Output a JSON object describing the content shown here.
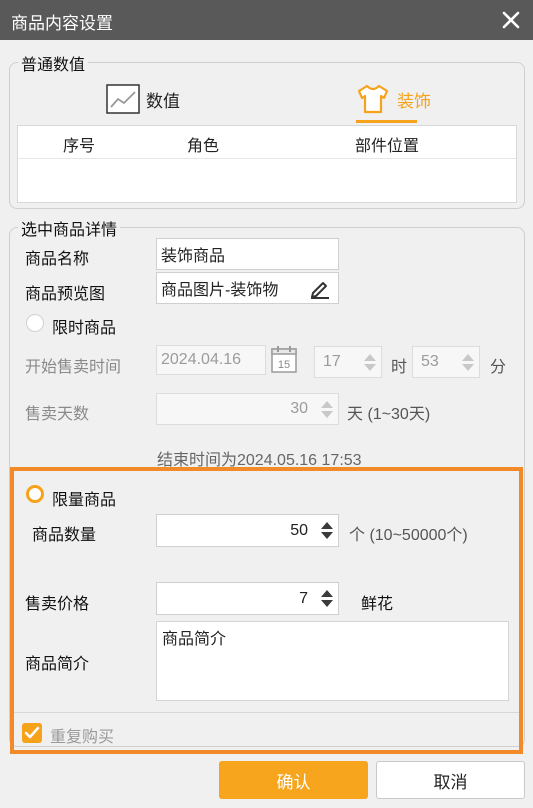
{
  "window": {
    "title": "商品内容设置"
  },
  "normal_values": {
    "legend": "普通数值",
    "tabs": [
      {
        "label": "数值",
        "icon": "chart-icon",
        "active": false
      },
      {
        "label": "装饰",
        "icon": "shirt-icon",
        "active": true
      }
    ],
    "table_headers": [
      "序号",
      "角色",
      "部件位置"
    ],
    "accent_color": "#f6a21a"
  },
  "details": {
    "legend": "选中商品详情",
    "name_label": "商品名称",
    "name_value": "装饰商品",
    "preview_label": "商品预览图",
    "preview_value": "商品图片-装饰物",
    "limited_time_label": "限时商品",
    "start_time_label": "开始售卖时间",
    "start_date": "2024.04.16",
    "calendar_day": "15",
    "hour": "17",
    "hour_unit": "时",
    "minute": "53",
    "minute_unit": "分",
    "days_label": "售卖天数",
    "days_value": "30",
    "days_hint": "天 (1~30天)",
    "end_time_text": "结束时间为2024.05.16 17:53",
    "limited_qty_label": "限量商品",
    "qty_label": "商品数量",
    "qty_value": "50",
    "qty_hint": "个 (10~50000个)",
    "price_label": "售卖价格",
    "price_value": "7",
    "price_unit": "鲜花",
    "desc_label": "商品简介",
    "desc_value": "商品简介",
    "repeat_label": "重复购买",
    "repeat_checked": true
  },
  "buttons": {
    "confirm": "确认",
    "cancel": "取消"
  },
  "highlight_color": "#f28a2a"
}
